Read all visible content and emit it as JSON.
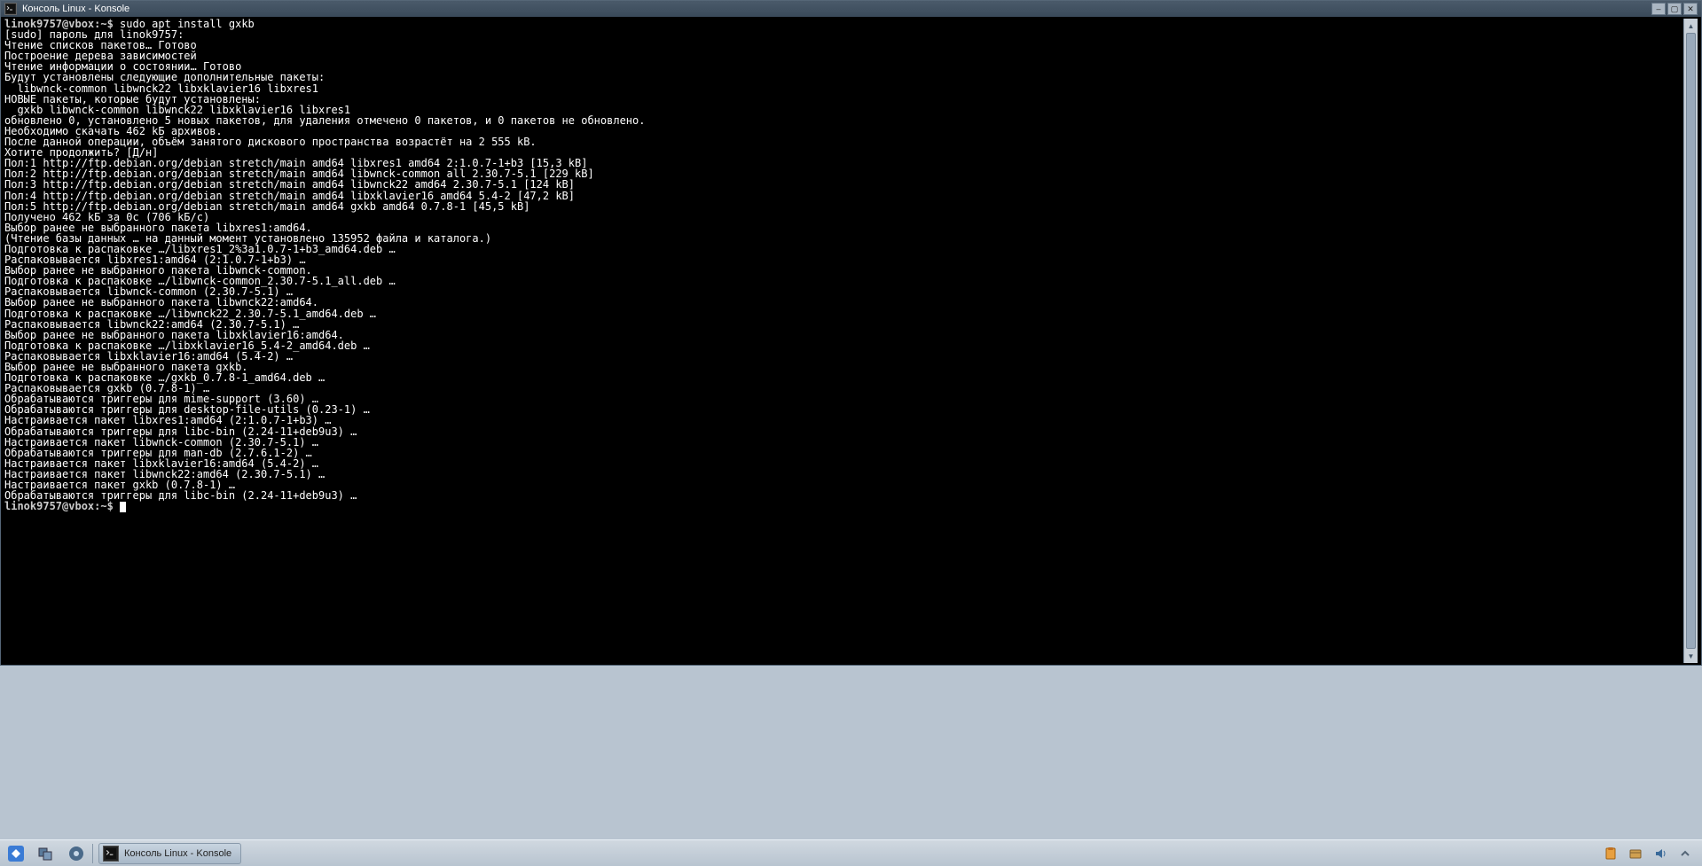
{
  "window": {
    "title": "Консоль Linux - Konsole"
  },
  "terminal": {
    "prompt1": "linok9757@vbox:~$ ",
    "cmd1": "sudo apt install gxkb",
    "lines": [
      "[sudo] пароль для linok9757: ",
      "Чтение списков пакетов… Готово",
      "Построение дерева зависимостей       ",
      "Чтение информации о состоянии… Готово",
      "Будут установлены следующие дополнительные пакеты:",
      "  libwnck-common libwnck22 libxklavier16 libxres1",
      "НОВЫЕ пакеты, которые будут установлены:",
      "  gxkb libwnck-common libwnck22 libxklavier16 libxres1",
      "обновлено 0, установлено 5 новых пакетов, для удаления отмечено 0 пакетов, и 0 пакетов не обновлено.",
      "Необходимо скачать 462 kБ архивов.",
      "После данной операции, объём занятого дискового пространства возрастёт на 2 555 kB.",
      "Хотите продолжить? [Д/н] ",
      "Пол:1 http://ftp.debian.org/debian stretch/main amd64 libxres1 amd64 2:1.0.7-1+b3 [15,3 kB]",
      "Пол:2 http://ftp.debian.org/debian stretch/main amd64 libwnck-common all 2.30.7-5.1 [229 kB]",
      "Пол:3 http://ftp.debian.org/debian stretch/main amd64 libwnck22 amd64 2.30.7-5.1 [124 kB]",
      "Пол:4 http://ftp.debian.org/debian stretch/main amd64 libxklavier16 amd64 5.4-2 [47,2 kB]",
      "Пол:5 http://ftp.debian.org/debian stretch/main amd64 gxkb amd64 0.7.8-1 [45,5 kB]",
      "Получено 462 kБ за 0с (706 kБ/c)   ",
      "Выбор ранее не выбранного пакета libxres1:amd64.",
      "(Чтение базы данных … на данный момент установлено 135952 файла и каталога.)",
      "Подготовка к распаковке …/libxres1_2%3a1.0.7-1+b3_amd64.deb …",
      "Распаковывается libxres1:amd64 (2:1.0.7-1+b3) …",
      "Выбор ранее не выбранного пакета libwnck-common.",
      "Подготовка к распаковке …/libwnck-common_2.30.7-5.1_all.deb …",
      "Распаковывается libwnck-common (2.30.7-5.1) …",
      "Выбор ранее не выбранного пакета libwnck22:amd64.",
      "Подготовка к распаковке …/libwnck22_2.30.7-5.1_amd64.deb …",
      "Распаковывается libwnck22:amd64 (2.30.7-5.1) …",
      "Выбор ранее не выбранного пакета libxklavier16:amd64.",
      "Подготовка к распаковке …/libxklavier16_5.4-2_amd64.deb …",
      "Распаковывается libxklavier16:amd64 (5.4-2) …",
      "Выбор ранее не выбранного пакета gxkb.",
      "Подготовка к распаковке …/gxkb_0.7.8-1_amd64.deb …",
      "Распаковывается gxkb (0.7.8-1) …",
      "Обрабатываются триггеры для mime-support (3.60) …",
      "Обрабатываются триггеры для desktop-file-utils (0.23-1) …",
      "Настраивается пакет libxres1:amd64 (2:1.0.7-1+b3) …",
      "Обрабатываются триггеры для libc-bin (2.24-11+deb9u3) …",
      "Настраивается пакет libwnck-common (2.30.7-5.1) …",
      "Обрабатываются триггеры для man-db (2.7.6.1-2) …",
      "Настраивается пакет libxklavier16:amd64 (5.4-2) …",
      "Настраивается пакет libwnck22:amd64 (2.30.7-5.1) …",
      "Настраивается пакет gxkb (0.7.8-1) …",
      "Обрабатываются триггеры для libc-bin (2.24-11+deb9u3) …"
    ],
    "prompt2": "linok9757@vbox:~$ "
  },
  "taskbar": {
    "task_label": "Консоль Linux - Konsole"
  }
}
